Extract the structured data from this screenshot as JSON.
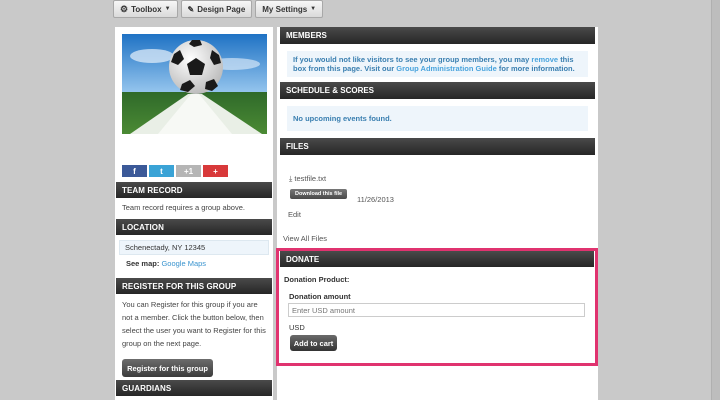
{
  "toolbar": {
    "toolbox_label": "Toolbox",
    "design_label": "Design Page",
    "settings_label": "My Settings"
  },
  "social": {
    "facebook": "f",
    "twitter": "t",
    "gplus": "+1",
    "plus": "+"
  },
  "team_record": {
    "title": "TEAM RECORD",
    "text": "Team record requires a group above."
  },
  "location": {
    "title": "LOCATION",
    "address": "Schenectady, NY 12345",
    "see_map_label": "See map:",
    "map_link": "Google Maps"
  },
  "register": {
    "title": "REGISTER FOR THIS GROUP",
    "text": "You can Register for this group if you are not a member. Click the button below, then select the user you want to Register for this group on the next page.",
    "button": "Register for this group"
  },
  "guardians": {
    "title": "GUARDIANS"
  },
  "members": {
    "title": "MEMBERS",
    "text_1": "If you would not like visitors to see your group members, you may",
    "remove_link": "remove",
    "text_2": "this box from this page. Visit our",
    "guide_link": "Group Administration Guide",
    "text_3": "for more information."
  },
  "schedule": {
    "title": "SCHEDULE & SCORES",
    "text": "No upcoming events found."
  },
  "files": {
    "title": "FILES",
    "filename": "testfile.txt",
    "download_button": "Download this file",
    "date": "11/26/2013",
    "edit_link": "Edit",
    "view_all_link": "View All Files"
  },
  "donate": {
    "title": "DONATE",
    "product_label": "Donation Product:",
    "amount_label": "Donation amount",
    "amount_placeholder": "Enter USD amount",
    "currency": "USD",
    "cart_button": "Add to cart"
  },
  "colors": {
    "highlight_border": "#e0336f",
    "link": "#3a94cf",
    "header_bg": "#2f2f2f"
  }
}
